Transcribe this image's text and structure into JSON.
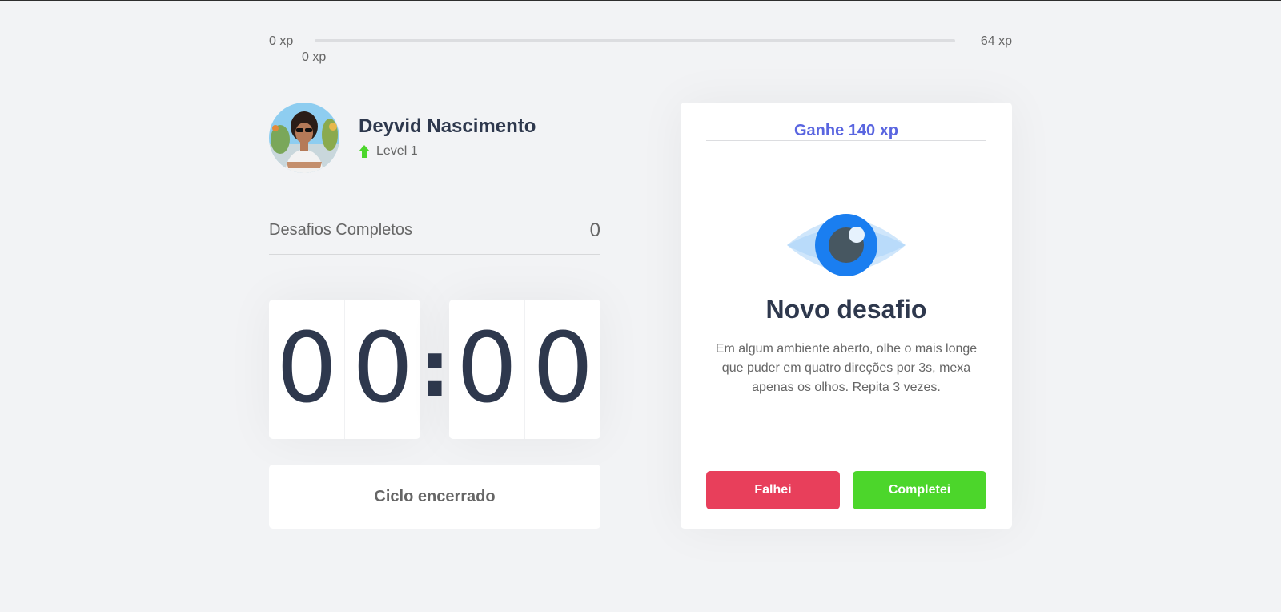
{
  "experience": {
    "min_label": "0 xp",
    "max_label": "64 xp",
    "current_label": "0 xp",
    "progress_fraction": 0
  },
  "profile": {
    "name": "Deyvid Nascimento",
    "level_label": "Level 1",
    "level_icon": "arrow-up-icon"
  },
  "completed_challenges": {
    "label": "Desafios Completos",
    "value": "0"
  },
  "countdown": {
    "minute_left": "0",
    "minute_right": "0",
    "separator": ":",
    "second_left": "0",
    "second_right": "0",
    "button_label": "Ciclo encerrado"
  },
  "challenge": {
    "header": "Ganhe 140 xp",
    "icon": "eye-icon",
    "title": "Novo desafio",
    "description": "Em algum ambiente aberto, olhe o mais longe que puder em quatro direções por 3s, mexa apenas os olhos. Repita 3 vezes.",
    "fail_label": "Falhei",
    "complete_label": "Completei"
  },
  "colors": {
    "background": "#f2f3f5",
    "title": "#2e384d",
    "text": "#666666",
    "blue": "#5965e0",
    "green": "#4cd62b",
    "red": "#e83f5b"
  }
}
